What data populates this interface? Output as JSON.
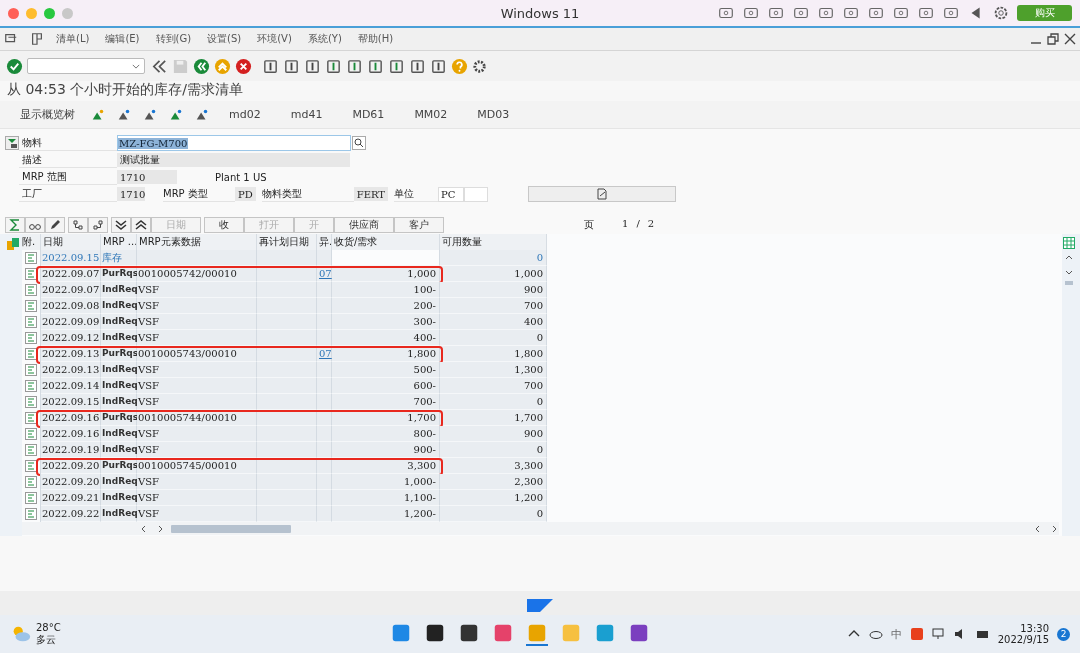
{
  "mac_window": {
    "title": "Windows 11",
    "buy_button": "购买"
  },
  "menu": [
    "清单(L)",
    "编辑(E)",
    "转到(G)",
    "设置(S)",
    "环境(V)",
    "系统(Y)",
    "帮助(H)"
  ],
  "screen_title": "从 04:53 个小时开始的库存/需求清单",
  "app_toolbar": {
    "overview_button": "显示概览树",
    "transactions": [
      "md02",
      "md41",
      "MD61",
      "MM02",
      "MD03"
    ]
  },
  "header": {
    "material": {
      "label": "物料",
      "value": "MZ-FG-M700"
    },
    "description": {
      "label": "描述",
      "value": "测试批量"
    },
    "mrp_area": {
      "label": "MRP 范围",
      "value": "1710",
      "text": "Plant 1 US"
    },
    "plant": {
      "label": "工厂",
      "value": "1710"
    },
    "mrp_type": {
      "label": "MRP 类型",
      "value": "PD"
    },
    "material_type": {
      "label": "物料类型",
      "value": "FERT"
    },
    "unit": {
      "label": "单位",
      "value": "PC"
    }
  },
  "table_toolbar": {
    "buttons": [
      {
        "label": "日期",
        "disabled": true
      },
      {
        "label": "收",
        "disabled": false
      },
      {
        "label": "打开",
        "disabled": true
      },
      {
        "label": "开",
        "disabled": true
      },
      {
        "label": "供应商",
        "disabled": false
      },
      {
        "label": "客户",
        "disabled": false
      }
    ],
    "page": {
      "label": "页",
      "current": "1",
      "separator": "/",
      "total": "2"
    }
  },
  "table": {
    "columns": [
      "附.",
      "日期",
      "MRP ...",
      "MRP元素数据",
      "再计划日期",
      "异.",
      "收货/需求",
      "可用数量"
    ],
    "rows": [
      {
        "kind": "stock",
        "date": "2022.09.15",
        "element": "库存",
        "available": "0",
        "highlighted": false
      },
      {
        "kind": "item",
        "date": "2022.09.07",
        "element": "PurRqs",
        "data": "0010005742/00010",
        "exception": "07",
        "quantity": "1,000",
        "available": "1,000",
        "highlighted": true
      },
      {
        "kind": "item",
        "date": "2022.09.07",
        "element": "IndReq",
        "data": "VSF",
        "quantity": "100-",
        "available": "900",
        "highlighted": false
      },
      {
        "kind": "item",
        "date": "2022.09.08",
        "element": "IndReq",
        "data": "VSF",
        "quantity": "200-",
        "available": "700",
        "highlighted": false
      },
      {
        "kind": "item",
        "date": "2022.09.09",
        "element": "IndReq",
        "data": "VSF",
        "quantity": "300-",
        "available": "400",
        "highlighted": false
      },
      {
        "kind": "item",
        "date": "2022.09.12",
        "element": "IndReq",
        "data": "VSF",
        "quantity": "400-",
        "available": "0",
        "highlighted": false
      },
      {
        "kind": "item",
        "date": "2022.09.13",
        "element": "PurRqs",
        "data": "0010005743/00010",
        "exception": "07",
        "quantity": "1,800",
        "available": "1,800",
        "highlighted": true
      },
      {
        "kind": "item",
        "date": "2022.09.13",
        "element": "IndReq",
        "data": "VSF",
        "quantity": "500-",
        "available": "1,300",
        "highlighted": false
      },
      {
        "kind": "item",
        "date": "2022.09.14",
        "element": "IndReq",
        "data": "VSF",
        "quantity": "600-",
        "available": "700",
        "highlighted": false
      },
      {
        "kind": "item",
        "date": "2022.09.15",
        "element": "IndReq",
        "data": "VSF",
        "quantity": "700-",
        "available": "0",
        "highlighted": false
      },
      {
        "kind": "item",
        "date": "2022.09.16",
        "element": "PurRqs",
        "data": "0010005744/00010",
        "quantity": "1,700",
        "available": "1,700",
        "highlighted": true
      },
      {
        "kind": "item",
        "date": "2022.09.16",
        "element": "IndReq",
        "data": "VSF",
        "quantity": "800-",
        "available": "900",
        "highlighted": false
      },
      {
        "kind": "item",
        "date": "2022.09.19",
        "element": "IndReq",
        "data": "VSF",
        "quantity": "900-",
        "available": "0",
        "highlighted": false
      },
      {
        "kind": "item",
        "date": "2022.09.20",
        "element": "PurRqs",
        "data": "0010005745/00010",
        "quantity": "3,300",
        "available": "3,300",
        "highlighted": true
      },
      {
        "kind": "item",
        "date": "2022.09.20",
        "element": "IndReq",
        "data": "VSF",
        "quantity": "1,000-",
        "available": "2,300",
        "highlighted": false
      },
      {
        "kind": "item",
        "date": "2022.09.21",
        "element": "IndReq",
        "data": "VSF",
        "quantity": "1,100-",
        "available": "1,200",
        "highlighted": false
      },
      {
        "kind": "item",
        "date": "2022.09.22",
        "element": "IndReq",
        "data": "VSF",
        "quantity": "1,200-",
        "available": "0",
        "highlighted": false
      }
    ]
  },
  "taskbar": {
    "temperature": "28°C",
    "weather": "多云",
    "ime": "中",
    "time": "13:30",
    "date": "2022/9/15",
    "notifications": "2"
  }
}
